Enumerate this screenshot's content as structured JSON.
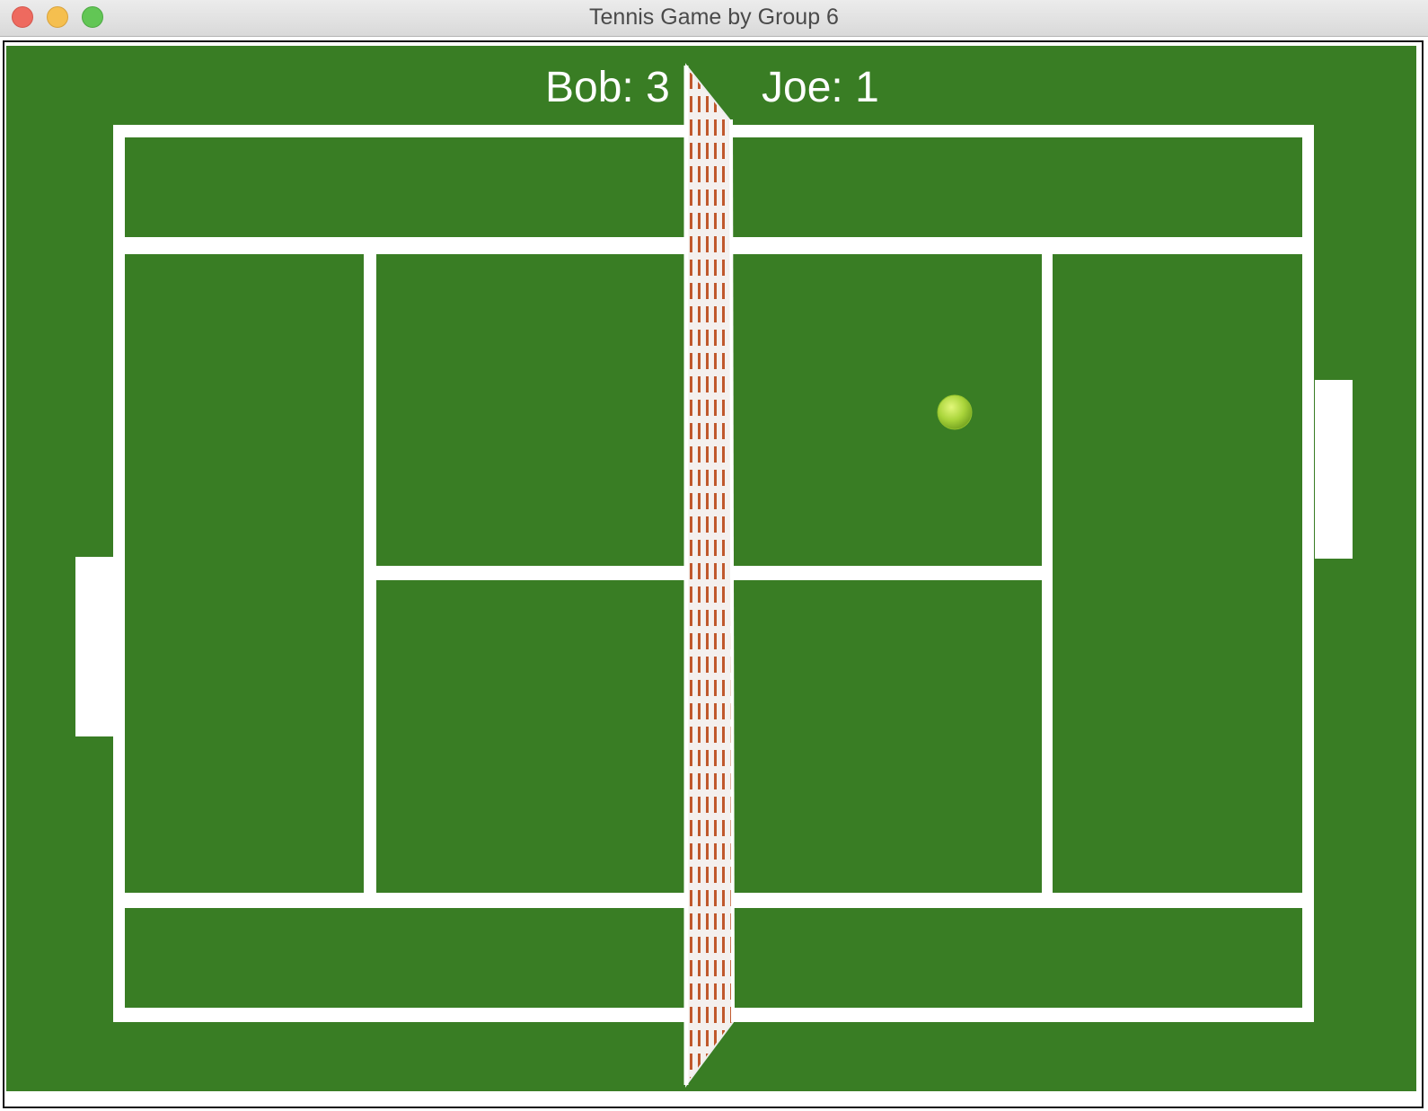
{
  "window": {
    "title": "Tennis Game by Group 6"
  },
  "scoreboard": {
    "left_score": "Bob: 3",
    "right_score": "Joe: 1"
  },
  "colors": {
    "court_green": "#397d24",
    "line_white": "#ffffff",
    "net_stripe": "#c0582c",
    "ball": "#b8e04a",
    "paddle": "#ffffff"
  }
}
